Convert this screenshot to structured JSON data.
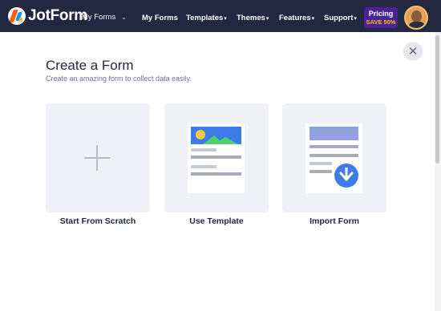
{
  "header": {
    "logo_text": "JotForm",
    "myforms_dropdown": "My Forms",
    "nav": [
      {
        "label": "My Forms",
        "caret": ""
      },
      {
        "label": "Templates",
        "caret": "▾"
      },
      {
        "label": "Themes",
        "caret": "▾"
      },
      {
        "label": "Features",
        "caret": "▾"
      },
      {
        "label": "Support",
        "caret": "▾"
      }
    ],
    "pricing_label": "Pricing",
    "pricing_promo": "SAVE 50%"
  },
  "modal": {
    "title": "Create a Form",
    "subtitle": "Create an amazing form to collect data easily.",
    "close_symbol": "✕",
    "options": [
      {
        "label": "Start From Scratch",
        "icon": "plus-icon"
      },
      {
        "label": "Use Template",
        "icon": "template-icon"
      },
      {
        "label": "Import Form",
        "icon": "import-icon"
      }
    ]
  },
  "colors": {
    "navbar": "#22283f",
    "pricing_bg": "#4a2296",
    "promo": "#ffc107",
    "accent_blue": "#3d7be8",
    "card_bg": "#f0f1f6"
  }
}
